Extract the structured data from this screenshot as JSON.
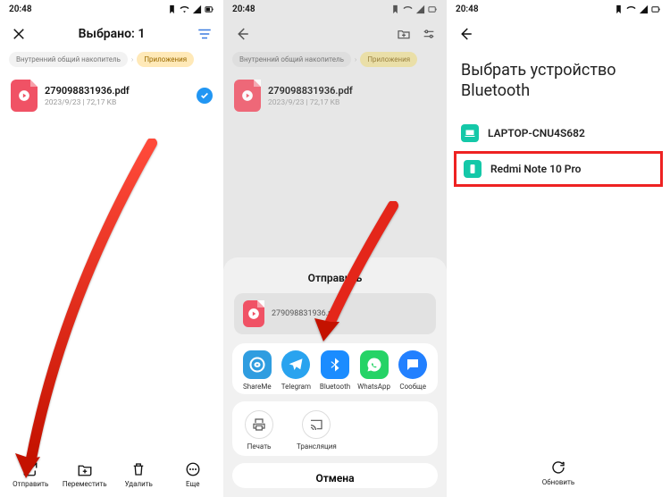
{
  "time": "20:48",
  "screen1": {
    "title": "Выбрано: 1",
    "crumb1": "Внутренний общий накопитель",
    "crumb2": "Приложения",
    "file": {
      "name": "279098831936.pdf",
      "meta": "2023/9/23 | 72,17 KB"
    },
    "bottom": {
      "send": "Отправить",
      "move": "Переместить",
      "delete": "Удалить",
      "more": "Еще"
    }
  },
  "screen2": {
    "crumb1": "Внутренний общий накопитель",
    "crumb2": "Приложения",
    "file": {
      "name": "279098831936.pdf",
      "meta": "2023/9/23 | 72,17 KB"
    },
    "sheet_title": "Отправить",
    "sheet_file": "279098831936.pdf",
    "apps": {
      "shareme": "ShareMe",
      "telegram": "Telegram",
      "bluetooth": "Bluetooth",
      "whatsapp": "WhatsApp",
      "messages": "Сообще"
    },
    "extras": {
      "print": "Печать",
      "cast": "Трансляция"
    },
    "cancel": "Отмена"
  },
  "screen3": {
    "title": "Выбрать устройство Bluetooth",
    "device1": "LAPTOP-CNU4S682",
    "device2": "Redmi Note 10 Pro",
    "refresh": "Обновить"
  }
}
